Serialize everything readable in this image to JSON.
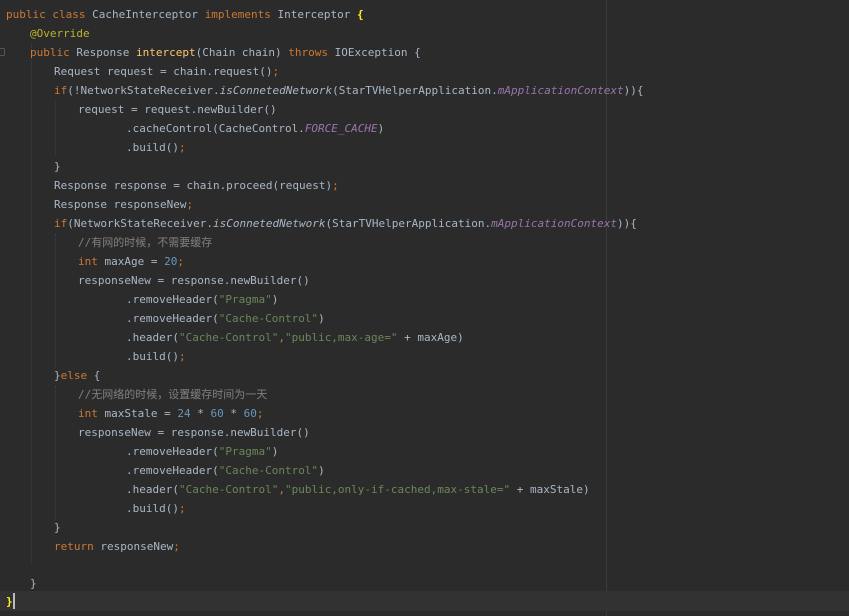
{
  "colors": {
    "background": "#2b2b2b",
    "keyword": "#cc7832",
    "annotation": "#bbb529",
    "method_decl": "#ffc66d",
    "string": "#6a8759",
    "number": "#6897bb",
    "field": "#9876aa",
    "comment": "#808080",
    "text": "#a9b7c6"
  },
  "code": {
    "l1": {
      "kw1": "public class ",
      "name": "CacheInterceptor ",
      "kw2": "implements ",
      "iface": "Interceptor ",
      "brace": "{"
    },
    "l2": {
      "annotation": "@Override"
    },
    "l3": {
      "kw1": "public ",
      "type": "Response ",
      "method": "intercept",
      "args": "(Chain chain) ",
      "kw2": "throws ",
      "exc": "IOException {"
    },
    "l4": {
      "text": "Request request = chain.request()",
      "semi": ";"
    },
    "l5": {
      "kw": "if",
      "p1": "(!NetworkStateReceiver.",
      "m": "isConnetedNetwork",
      "p2": "(StarTVHelperApplication.",
      "f": "mApplicationContext",
      "p3": ")){"
    },
    "l6": {
      "text": "request = request.newBuilder()"
    },
    "l7": {
      "p1": ".cacheControl(CacheControl.",
      "f": "FORCE_CACHE",
      "p2": ")"
    },
    "l8": {
      "text": ".build()",
      "semi": ";"
    },
    "l9": {
      "text": "}"
    },
    "l10": {
      "text": "Response response = chain.proceed(request)",
      "semi": ";"
    },
    "l11": {
      "text": "Response responseNew",
      "semi": ";"
    },
    "l12": {
      "kw": "if",
      "p1": "(NetworkStateReceiver.",
      "m": "isConnetedNetwork",
      "p2": "(StarTVHelperApplication.",
      "f": "mApplicationContext",
      "p3": ")){"
    },
    "l13": {
      "comment": "//有网的时候，不需要缓存"
    },
    "l14": {
      "kw": "int ",
      "var": "maxAge = ",
      "num": "20",
      "semi": ";"
    },
    "l15": {
      "text": "responseNew = response.newBuilder()"
    },
    "l16": {
      "p1": ".removeHeader(",
      "s": "\"Pragma\"",
      "p2": ")"
    },
    "l17": {
      "p1": ".removeHeader(",
      "s": "\"Cache-Control\"",
      "p2": ")"
    },
    "l18": {
      "p1": ".header(",
      "s1": "\"Cache-Control\"",
      "comma": ",",
      "s2": "\"public,max-age=\"",
      "p2": " + maxAge)"
    },
    "l19": {
      "text": ".build()",
      "semi": ";"
    },
    "l20": {
      "p1": "}",
      "kw": "else ",
      "p2": "{"
    },
    "l21": {
      "comment": "//无网络的时候，设置缓存时间为一天"
    },
    "l22": {
      "kw": "int ",
      "var": "maxStale = ",
      "n1": "24",
      "op1": " * ",
      "n2": "60",
      "op2": " * ",
      "n3": "60",
      "semi": ";"
    },
    "l23": {
      "text": "responseNew = response.newBuilder()"
    },
    "l24": {
      "p1": ".removeHeader(",
      "s": "\"Pragma\"",
      "p2": ")"
    },
    "l25": {
      "p1": ".removeHeader(",
      "s": "\"Cache-Control\"",
      "p2": ")"
    },
    "l26": {
      "p1": ".header(",
      "s1": "\"Cache-Control\"",
      "comma": ",",
      "s2": "\"public,only-if-cached,max-stale=\"",
      "p2": " + maxStale)"
    },
    "l27": {
      "text": ".build()",
      "semi": ";"
    },
    "l28": {
      "text": "}"
    },
    "l29": {
      "kw": "return ",
      "text": "responseNew",
      "semi": ";"
    },
    "l31": {
      "text": "}"
    },
    "l32": {
      "brace": "}"
    }
  }
}
